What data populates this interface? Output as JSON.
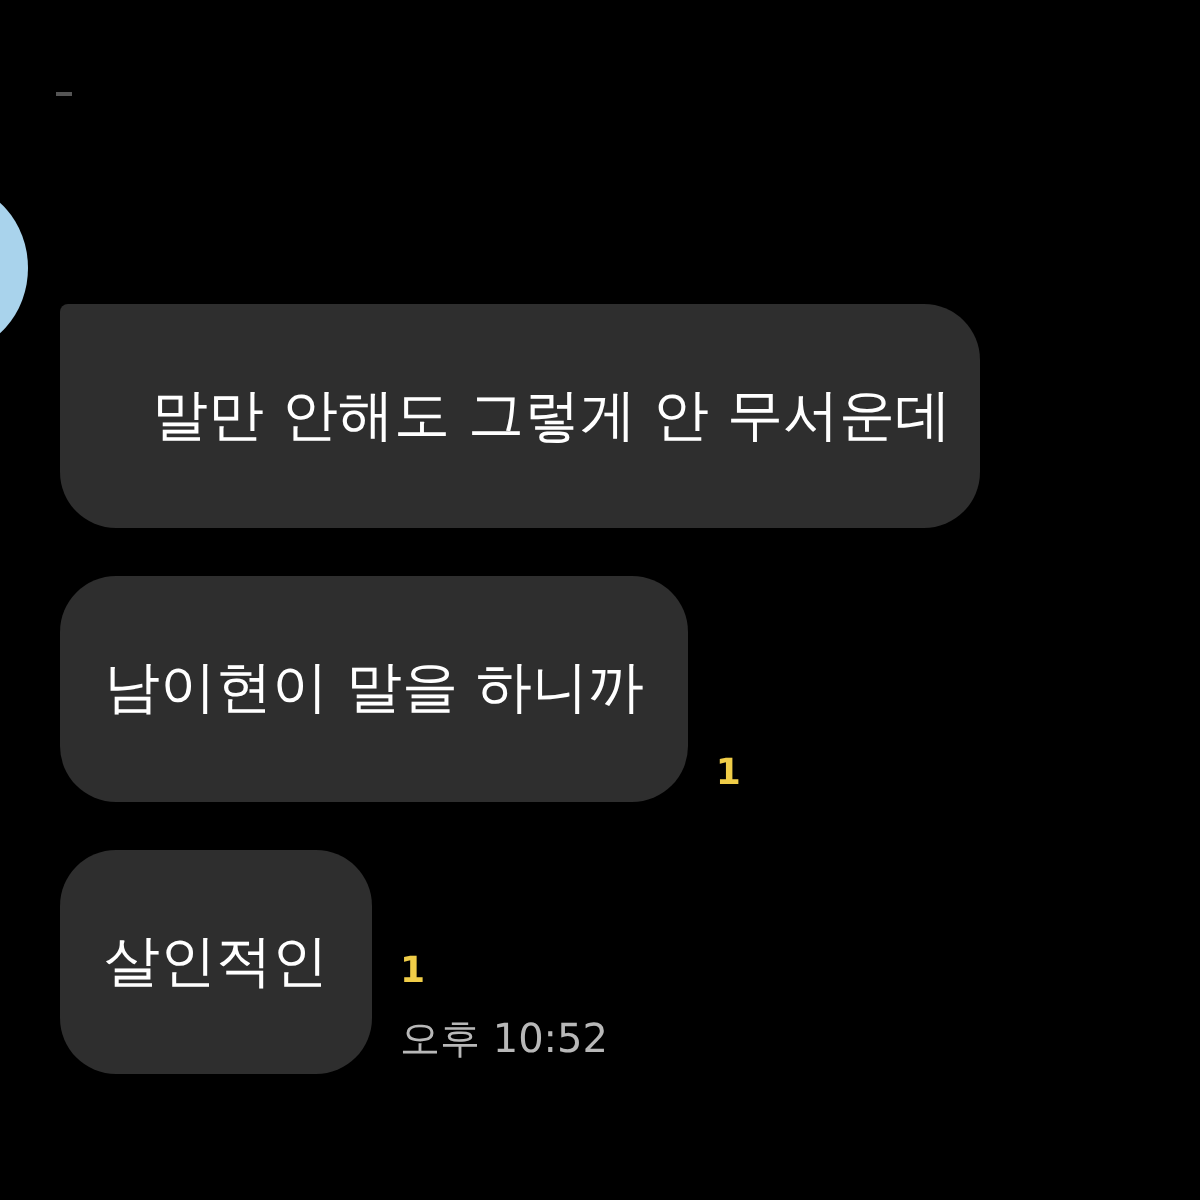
{
  "messages": [
    {
      "text": "말만 안해도 그렇게 안 무서운데",
      "first": true
    },
    {
      "text": "남이현이 말을 하니까",
      "unread": "1",
      "first": false
    },
    {
      "text": "살인적인",
      "unread": "1",
      "time": "오후 10:52",
      "first": false
    }
  ]
}
